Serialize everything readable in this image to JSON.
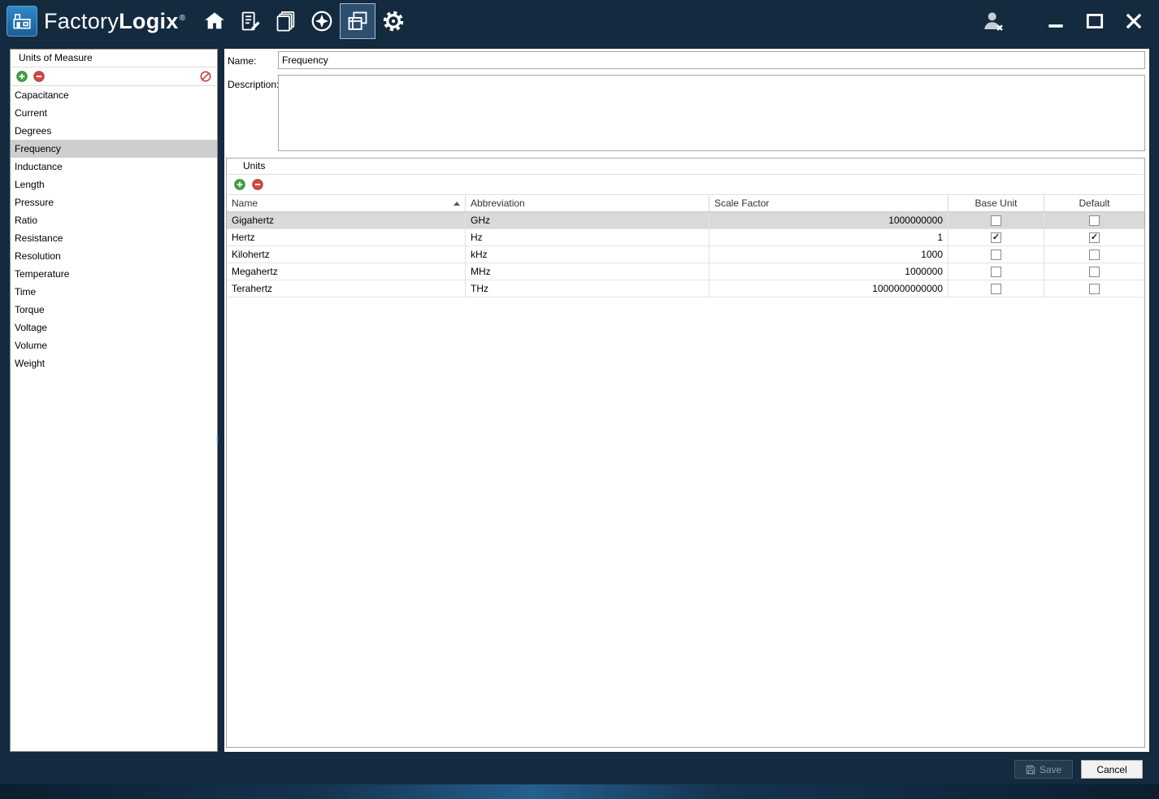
{
  "titlebar": {
    "app_name_light": "Factory",
    "app_name_bold": "Logix",
    "registered_mark": "®",
    "nav_icons": [
      "home-icon",
      "document-edit-icon",
      "layers-icon",
      "compass-icon",
      "panels-icon",
      "gear-icon"
    ],
    "active_nav_icon": "panels-icon",
    "right_icons": [
      "user-logout-icon",
      "minimize-icon",
      "maximize-icon",
      "close-icon"
    ]
  },
  "sidebar": {
    "title": "Units of Measure",
    "toolbar_icons": [
      "add-icon",
      "remove-icon",
      "cancel-edit-icon"
    ],
    "items": [
      {
        "label": "Capacitance",
        "selected": false
      },
      {
        "label": "Current",
        "selected": false
      },
      {
        "label": "Degrees",
        "selected": false
      },
      {
        "label": "Frequency",
        "selected": true
      },
      {
        "label": "Inductance",
        "selected": false
      },
      {
        "label": "Length",
        "selected": false
      },
      {
        "label": "Pressure",
        "selected": false
      },
      {
        "label": "Ratio",
        "selected": false
      },
      {
        "label": "Resistance",
        "selected": false
      },
      {
        "label": "Resolution",
        "selected": false
      },
      {
        "label": "Temperature",
        "selected": false
      },
      {
        "label": "Time",
        "selected": false
      },
      {
        "label": "Torque",
        "selected": false
      },
      {
        "label": "Voltage",
        "selected": false
      },
      {
        "label": "Volume",
        "selected": false
      },
      {
        "label": "Weight",
        "selected": false
      }
    ]
  },
  "form": {
    "name_label": "Name:",
    "name_value": "Frequency",
    "description_label": "Description:",
    "description_value": ""
  },
  "units_panel": {
    "title": "Units",
    "toolbar_icons": [
      "add-icon",
      "remove-icon"
    ],
    "columns": {
      "name": "Name",
      "abbreviation": "Abbreviation",
      "scale_factor": "Scale Factor",
      "base_unit": "Base Unit",
      "default": "Default"
    },
    "sort_column": "Name",
    "sort_direction": "ascending",
    "rows": [
      {
        "name": "Gigahertz",
        "abbreviation": "GHz",
        "scale_factor": "1000000000",
        "base_unit": false,
        "default": false,
        "selected": true
      },
      {
        "name": "Hertz",
        "abbreviation": "Hz",
        "scale_factor": "1",
        "base_unit": true,
        "default": true,
        "selected": false
      },
      {
        "name": "Kilohertz",
        "abbreviation": "kHz",
        "scale_factor": "1000",
        "base_unit": false,
        "default": false,
        "selected": false
      },
      {
        "name": "Megahertz",
        "abbreviation": "MHz",
        "scale_factor": "1000000",
        "base_unit": false,
        "default": false,
        "selected": false
      },
      {
        "name": "Terahertz",
        "abbreviation": "THz",
        "scale_factor": "1000000000000",
        "base_unit": false,
        "default": false,
        "selected": false
      }
    ]
  },
  "footer": {
    "save_label": "Save",
    "cancel_label": "Cancel",
    "save_enabled": false
  },
  "colors": {
    "titlebar_bg": "#132a3f",
    "logo_blue": "#2480c0",
    "active_nav_bg": "#2c4f70",
    "selected_row": "#d9d9d9",
    "selected_list_item": "#cecece",
    "panel_border": "#a6a6a6",
    "add_green": "#44a549",
    "remove_red": "#d24a43"
  }
}
